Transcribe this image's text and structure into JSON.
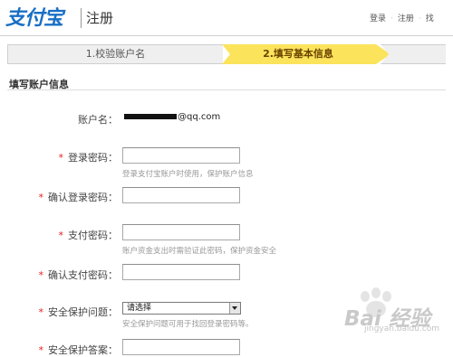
{
  "header": {
    "logo_text": "支付宝",
    "page_title": "注册",
    "links": [
      "登录",
      "注册",
      "找"
    ]
  },
  "steps": [
    {
      "label": "1.校验账户名",
      "active": false
    },
    {
      "label": "2.填写基本信息",
      "active": true
    },
    {
      "label": "",
      "active": false
    }
  ],
  "section": {
    "title": "填写账户信息"
  },
  "form": {
    "account_label": "账户名：",
    "account_value_suffix": "@qq.com",
    "login_password_label": "登录密码：",
    "login_password_hint": "登录支付宝账户时使用，保护账户信息",
    "confirm_login_password_label": "确认登录密码：",
    "pay_password_label": "支付密码：",
    "pay_password_hint": "账户资金支出时需验证此密码，保护资金安全",
    "confirm_pay_password_label": "确认支付密码：",
    "security_question_label": "安全保护问题：",
    "security_question_selected": "请选择",
    "security_question_hint": "安全保护问题可用于找回登录密码等。",
    "security_answer_label": "安全保护答案："
  },
  "watermark": {
    "brand": "Bai 经验",
    "url": "jingyan.baidu.com"
  },
  "colors": {
    "brand_blue": "#1a6fc4",
    "active_step": "#fbe35c",
    "required_star": "#e02020"
  }
}
